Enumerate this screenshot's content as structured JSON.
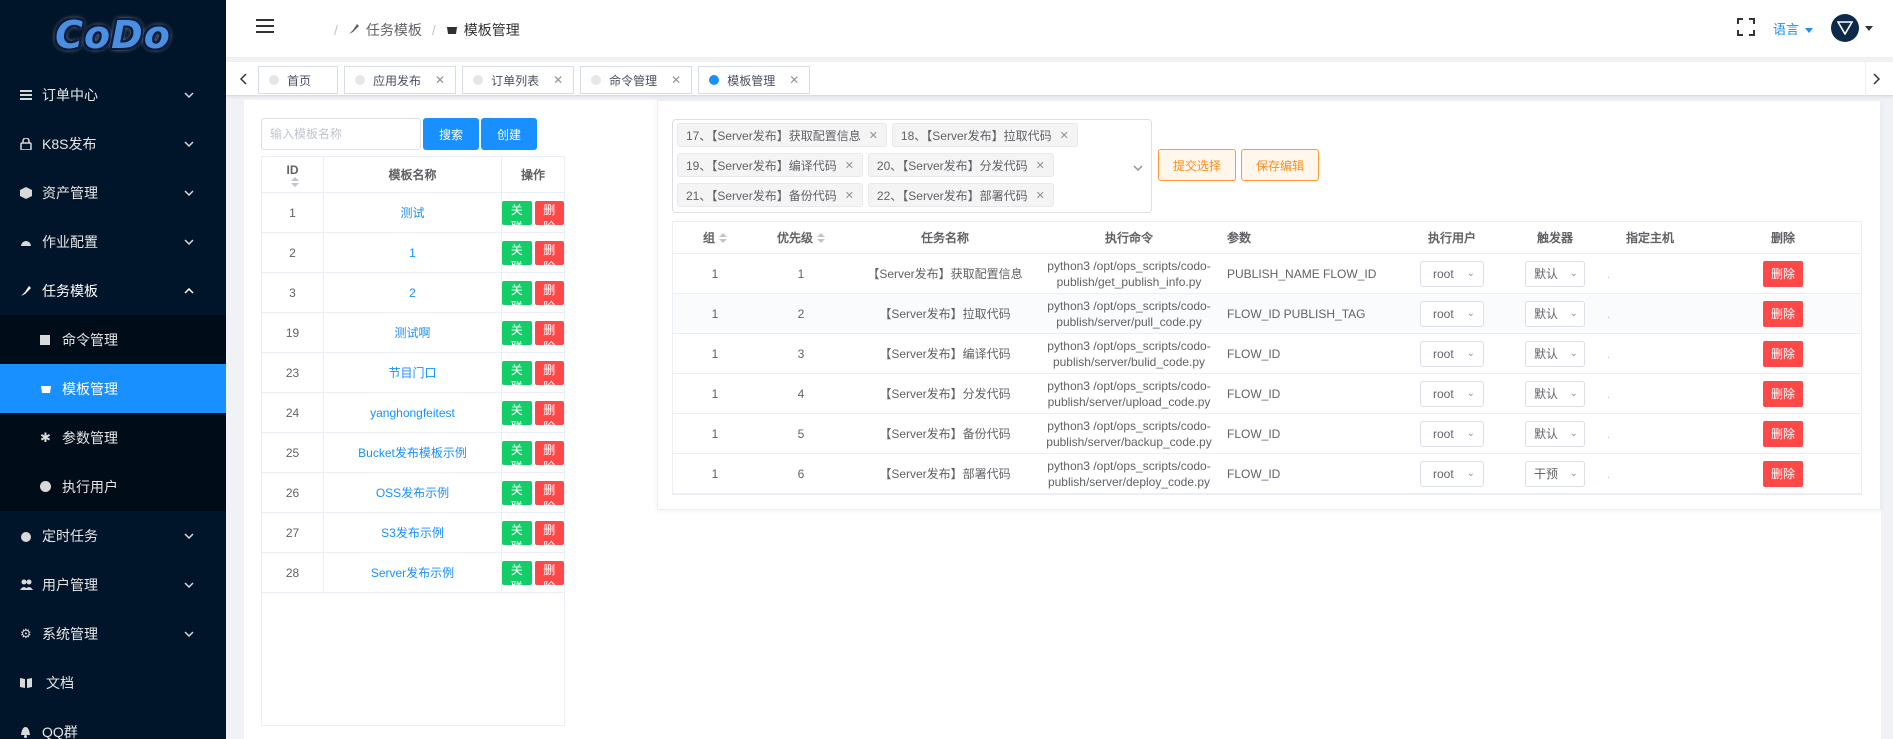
{
  "logo": {
    "text": "CoDo"
  },
  "sidebar": {
    "items": [
      {
        "label": "订单中心",
        "icon": "list-icon"
      },
      {
        "label": "K8S发布",
        "icon": "lock-icon"
      },
      {
        "label": "资产管理",
        "icon": "cube-icon"
      },
      {
        "label": "作业配置",
        "icon": "gauge-icon"
      },
      {
        "label": "任务模板",
        "icon": "brush-icon"
      },
      {
        "label": "定时任务",
        "icon": "alarm-icon"
      },
      {
        "label": "用户管理",
        "icon": "users-icon"
      },
      {
        "label": "系统管理",
        "icon": "gear-icon"
      },
      {
        "label": "文档",
        "icon": "book-icon"
      },
      {
        "label": "QQ群",
        "icon": "bell-icon"
      }
    ],
    "sub_items": [
      {
        "label": "命令管理",
        "icon": "square-icon"
      },
      {
        "label": "模板管理",
        "icon": "template-icon"
      },
      {
        "label": "参数管理",
        "icon": "asterisk-icon"
      },
      {
        "label": "执行用户",
        "icon": "user-circle-icon"
      }
    ]
  },
  "header": {
    "breadcrumb": [
      "任务模板",
      "模板管理"
    ],
    "lang_label": "语言"
  },
  "tabs": [
    {
      "label": "首页"
    },
    {
      "label": "应用发布"
    },
    {
      "label": "订单列表"
    },
    {
      "label": "命令管理"
    },
    {
      "label": "模板管理"
    }
  ],
  "left": {
    "search_placeholder": "输入模板名称",
    "search_label": "搜索",
    "create_label": "创建",
    "columns": {
      "id": "ID",
      "name": "模板名称",
      "op": "操作"
    },
    "link_label": "关联",
    "delete_label": "删除",
    "rows": [
      {
        "id": "1",
        "name": "测试"
      },
      {
        "id": "2",
        "name": "1"
      },
      {
        "id": "3",
        "name": "2"
      },
      {
        "id": "19",
        "name": "测试啊"
      },
      {
        "id": "23",
        "name": "节目门口"
      },
      {
        "id": "24",
        "name": "yanghongfeitest"
      },
      {
        "id": "25",
        "name": "Bucket发布模板示例"
      },
      {
        "id": "26",
        "name": "OSS发布示例"
      },
      {
        "id": "27",
        "name": "S3发布示例"
      },
      {
        "id": "28",
        "name": "Server发布示例"
      }
    ]
  },
  "right": {
    "tags": [
      "17、【Server发布】获取配置信息",
      "18、【Server发布】拉取代码",
      "19、【Server发布】编译代码",
      "20、【Server发布】分发代码",
      "21、【Server发布】备份代码",
      "22、【Server发布】部署代码"
    ],
    "submit_label": "提交选择",
    "save_label": "保存编辑",
    "columns": {
      "group": "组",
      "priority": "优先级",
      "task_name": "任务名称",
      "command": "执行命令",
      "params": "参数",
      "exec_user": "执行用户",
      "trigger": "触发器",
      "host": "指定主机",
      "delete": "删除"
    },
    "delete_label": "删除",
    "rows": [
      {
        "group": "1",
        "priority": "1",
        "task_name": "【Server发布】获取配置信息",
        "command": "python3 /opt/ops_scripts/codo-publish/get_publish_info.py",
        "params": "PUBLISH_NAME FLOW_ID",
        "exec_user": "root",
        "trigger": "默认",
        "host": "."
      },
      {
        "group": "1",
        "priority": "2",
        "task_name": "【Server发布】拉取代码",
        "command": "python3 /opt/ops_scripts/codo-publish/server/pull_code.py",
        "params": "FLOW_ID PUBLISH_TAG",
        "exec_user": "root",
        "trigger": "默认",
        "host": "."
      },
      {
        "group": "1",
        "priority": "3",
        "task_name": "【Server发布】编译代码",
        "command": "python3 /opt/ops_scripts/codo-publish/server/bulid_code.py",
        "params": "FLOW_ID",
        "exec_user": "root",
        "trigger": "默认",
        "host": "."
      },
      {
        "group": "1",
        "priority": "4",
        "task_name": "【Server发布】分发代码",
        "command": "python3 /opt/ops_scripts/codo-publish/server/upload_code.py",
        "params": "FLOW_ID",
        "exec_user": "root",
        "trigger": "默认",
        "host": "."
      },
      {
        "group": "1",
        "priority": "5",
        "task_name": "【Server发布】备份代码",
        "command": "python3 /opt/ops_scripts/codo-publish/server/backup_code.py",
        "params": "FLOW_ID",
        "exec_user": "root",
        "trigger": "默认",
        "host": "."
      },
      {
        "group": "1",
        "priority": "6",
        "task_name": "【Server发布】部署代码",
        "command": "python3 /opt/ops_scripts/codo-publish/server/deploy_code.py",
        "params": "FLOW_ID",
        "exec_user": "root",
        "trigger": "干预",
        "host": "."
      }
    ]
  },
  "colors": {
    "primary": "#1890ff",
    "sidebar_bg": "#001529",
    "success": "#13ce66",
    "danger": "#ff4949",
    "warning": "#ff9933"
  }
}
